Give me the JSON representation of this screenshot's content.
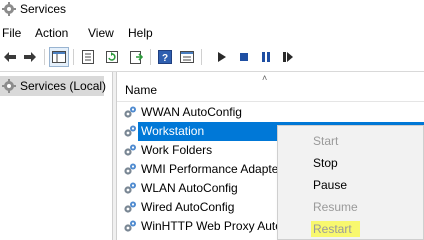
{
  "window": {
    "title": "Services",
    "icon": "gear-icon"
  },
  "menu": {
    "items": [
      "File",
      "Action",
      "View",
      "Help"
    ]
  },
  "toolbar": {
    "buttons": [
      "back-arrow-icon",
      "forward-arrow-icon",
      "show-console-tree-icon",
      "properties-icon",
      "refresh-icon",
      "export-list-icon",
      "help-icon",
      "console-pane-icon",
      "start-service-icon",
      "stop-service-icon",
      "pause-service-icon",
      "restart-service-icon"
    ],
    "colors": {
      "arrow": "#3a3a3a",
      "play": "#2a2a2a",
      "stop": "#1f4fa3",
      "pause": "#1f4fa3",
      "restart": "#2a2a2a"
    }
  },
  "tree": {
    "root_label": "Services (Local)"
  },
  "list": {
    "column_name": "Name",
    "rows": [
      "WWAN AutoConfig",
      "Workstation",
      "Work Folders",
      "WMI Performance Adapter",
      "WLAN AutoConfig",
      "Wired AutoConfig",
      "WinHTTP Web Proxy Auto-Discovery Service"
    ],
    "selected_index": 1,
    "selection_color": "#0078d7"
  },
  "context_menu": {
    "items": [
      {
        "label": "Start",
        "enabled": false
      },
      {
        "label": "Stop",
        "enabled": true
      },
      {
        "label": "Pause",
        "enabled": true
      },
      {
        "label": "Resume",
        "enabled": false
      },
      {
        "label": "Restart",
        "enabled": false,
        "highlight": "#f8f86e"
      }
    ]
  }
}
